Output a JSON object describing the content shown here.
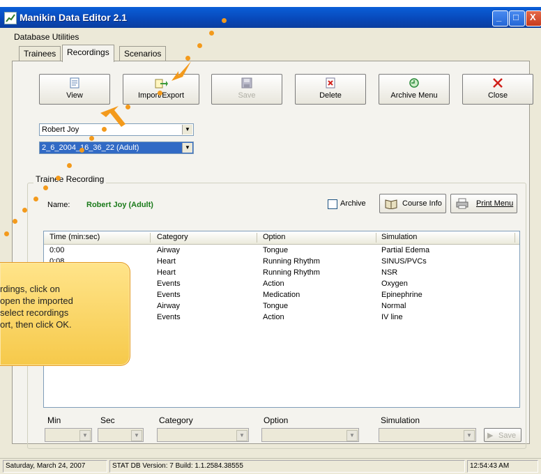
{
  "window": {
    "title": "Manikin Data Editor 2.1",
    "minimize": "_",
    "maximize": "□",
    "close": "X"
  },
  "menu": {
    "database_utilities": "Database Utilities"
  },
  "tabs": [
    {
      "label": "Trainees"
    },
    {
      "label": "Recordings"
    },
    {
      "label": "Scenarios"
    }
  ],
  "toolbar": {
    "view": "View",
    "import_export": "Import/Export",
    "save": "Save",
    "delete": "Delete",
    "archive_menu": "Archive Menu",
    "close": "Close"
  },
  "selectors": {
    "trainee": "Robert Joy",
    "recording": "2_6_2004_16_36_22 (Adult)"
  },
  "trainee_recording": {
    "group_label": "Trainee Recording",
    "name_label": "Name:",
    "name_value": "Robert Joy (Adult)",
    "archive_label": "Archive",
    "course_info": "Course Info",
    "print_menu": "Print Menu"
  },
  "table": {
    "columns": [
      "Time (min:sec)",
      "Category",
      "Option",
      "Simulation"
    ],
    "rows": [
      [
        "0:00",
        "Airway",
        "Tongue",
        "Partial Edema"
      ],
      [
        "0:08",
        "Heart",
        "Running Rhythm",
        "SINUS/PVCs"
      ],
      [
        "",
        "Heart",
        "Running Rhythm",
        "NSR"
      ],
      [
        "",
        "Events",
        "Action",
        "Oxygen"
      ],
      [
        "",
        "Events",
        "Medication",
        "Epinephrine"
      ],
      [
        "",
        "Airway",
        "Tongue",
        "Normal"
      ],
      [
        "",
        "Events",
        "Action",
        "IV line"
      ]
    ]
  },
  "editor": {
    "min": "Min",
    "sec": "Sec",
    "category": "Category",
    "option": "Option",
    "simulation": "Simulation",
    "save": "Save"
  },
  "callout": {
    "lines": [
      "rdings, click on",
      "open the imported",
      "select recordings",
      "ort, then click OK."
    ]
  },
  "status": {
    "date": "Saturday, March 24, 2007",
    "version": "STAT DB Version: 7  Build: 1.1.2584.38555",
    "time": "12:54:43 AM"
  },
  "colors": {
    "title_blue": "#0A5FD8",
    "callout_yellow": "#F6C94A",
    "name_green": "#1A7A1A",
    "selection_blue": "#316AC5"
  }
}
